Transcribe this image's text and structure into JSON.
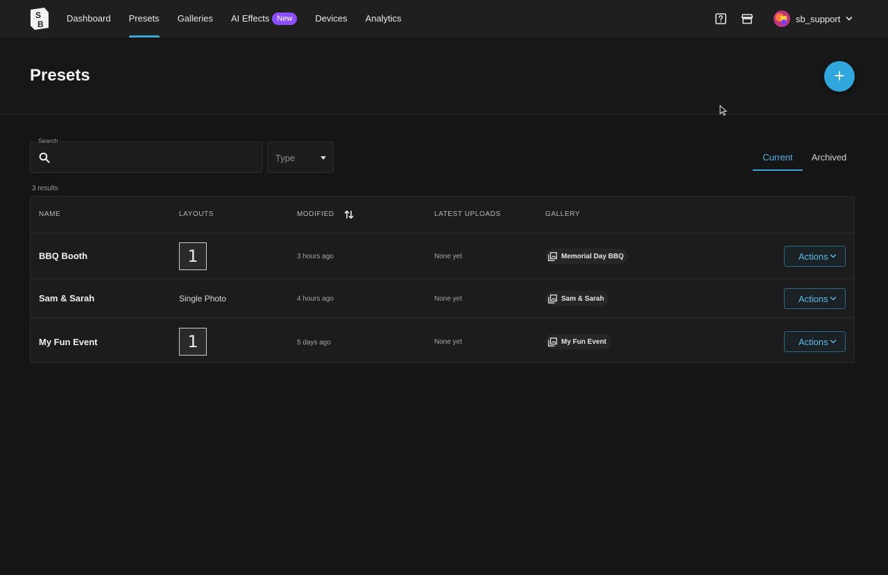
{
  "nav": {
    "links": [
      {
        "label": "Dashboard",
        "active": false
      },
      {
        "label": "Presets",
        "active": true
      },
      {
        "label": "Galleries",
        "active": false
      },
      {
        "label": "AI Effects",
        "active": false,
        "badge": "New"
      },
      {
        "label": "Devices",
        "active": false
      },
      {
        "label": "Analytics",
        "active": false
      }
    ],
    "icons": [
      "help-icon",
      "store-icon"
    ],
    "user": {
      "name": "sb_support"
    }
  },
  "header": {
    "title": "Presets",
    "add_button": "+"
  },
  "filters": {
    "search_label": "Search",
    "search_value": "",
    "type_placeholder": "Type",
    "tabs": [
      {
        "label": "Current",
        "active": true
      },
      {
        "label": "Archived",
        "active": false
      }
    ],
    "results_text": "3 results"
  },
  "table": {
    "columns": [
      "NAME",
      "LAYOUTS",
      "MODIFIED",
      "LATEST UPLOADS",
      "GALLERY"
    ],
    "rows": [
      {
        "name": "BBQ Booth",
        "layout": "1",
        "layout_type": "thumb",
        "modified": "3 hours ago",
        "uploads": "None yet",
        "gallery": "Memorial Day BBQ",
        "action": "Actions"
      },
      {
        "name": "Sam & Sarah",
        "layout": "Single Photo",
        "layout_type": "text",
        "modified": "4 hours ago",
        "uploads": "None yet",
        "gallery": "Sam & Sarah",
        "action": "Actions"
      },
      {
        "name": "My Fun Event",
        "layout": "1",
        "layout_type": "thumb",
        "modified": "5 days ago",
        "uploads": "None yet",
        "gallery": "My Fun Event",
        "action": "Actions"
      }
    ]
  },
  "colors": {
    "accent": "#3aa8db",
    "badge": "#8a4dff",
    "background": "#151515"
  }
}
